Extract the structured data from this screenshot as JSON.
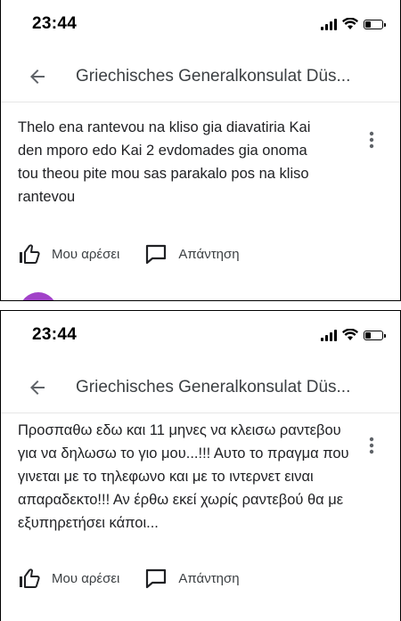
{
  "screens": [
    {
      "status_time": "23:44",
      "app_title": "Griechisches Generalkonsulat Düs...",
      "review_text": "Thelo ena rantevou na kliso gia diavatiria Kai den mporo edo Kai 2 evdomades gia onoma tou theou pite mou sas parakalo pos na kliso rantevou",
      "like_label": "Μου αρέσει",
      "reply_label": "Απάντηση"
    },
    {
      "status_time": "23:44",
      "app_title": "Griechisches Generalkonsulat Düs...",
      "review_text": "Προσπαθω εδω και 11 μηνες να κλεισω ραντεβου για να δηλωσω το γιο μου...!!! Αυτο το πραγμα που γινεται με το τηλεφωνο και με το ιντερνετ ειναι απαραδεκτο!!! Αν έρθω εκεί χωρίς ραντεβού θα με εξυπηρετήσει κάποι...",
      "like_label": "Μου αρέσει",
      "reply_label": "Απάντηση"
    }
  ],
  "colors": {
    "avatar": "#a142c8",
    "text": "#202124",
    "secondary_text": "#3c4043"
  },
  "icons": [
    "back-arrow-icon",
    "more-vert-icon",
    "thumb-up-icon",
    "reply-comment-icon",
    "signal-icon",
    "wifi-icon",
    "battery-icon"
  ]
}
